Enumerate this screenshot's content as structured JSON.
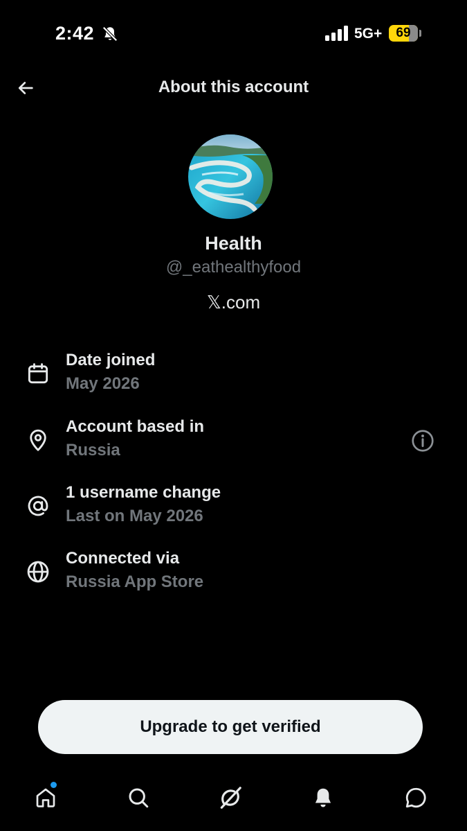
{
  "status_bar": {
    "time": "2:42",
    "network": "5G+",
    "battery": "69",
    "battery_level": 0.69,
    "mute_icon": "bell-slash-icon",
    "signal_icon": "cellular-signal-icon"
  },
  "header": {
    "title": "About this account",
    "back_icon": "arrow-left-icon"
  },
  "profile": {
    "name": "Health",
    "handle": "@_eathealthyfood",
    "site": "𝕏.com",
    "avatar_icon": "coastline-photo-avatar"
  },
  "info": [
    {
      "label": "Date joined",
      "value": "May 2026",
      "icon": "calendar-icon"
    },
    {
      "label": "Account based in",
      "value": "Russia",
      "icon": "location-pin-icon",
      "action_icon": "info-circle-icon"
    },
    {
      "label": "1 username change",
      "value": "Last on May 2026",
      "icon": "at-sign-icon"
    },
    {
      "label": "Connected via",
      "value": "Russia App Store",
      "icon": "globe-icon"
    }
  ],
  "upgrade": {
    "label": "Upgrade to get verified"
  },
  "nav": {
    "items": [
      "home-icon",
      "search-icon",
      "grok-icon",
      "notifications-icon",
      "messages-icon"
    ],
    "home_has_badge": true
  },
  "colors": {
    "background": "#000000",
    "primary_text": "#e7e9ea",
    "secondary_text": "#71767b",
    "accent": "#1d9bf0",
    "battery": "#ffd60a",
    "button_bg": "#eff3f4"
  }
}
